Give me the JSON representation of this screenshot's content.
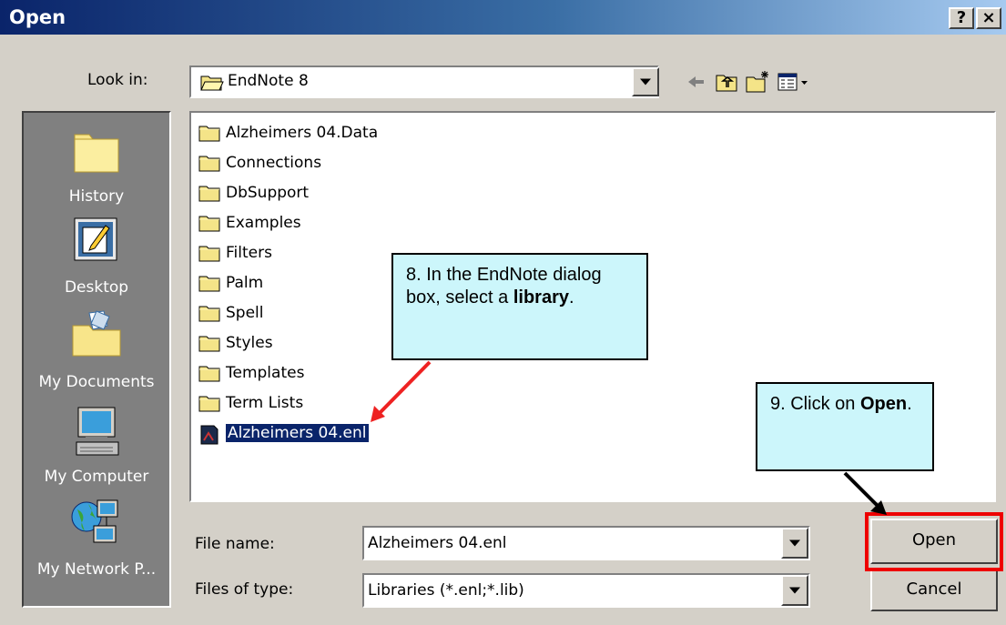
{
  "title": "Open",
  "title_buttons": {
    "help": "?",
    "close": "×"
  },
  "look_in": {
    "label": "Look in:",
    "value": "EndNote 8"
  },
  "toolbar": [
    "back-arrow-icon",
    "up-folder-icon",
    "new-folder-icon",
    "view-menu-icon"
  ],
  "places": [
    {
      "label": "History",
      "icon": "history-folder-icon"
    },
    {
      "label": "Desktop",
      "icon": "desktop-icon"
    },
    {
      "label": "My Documents",
      "icon": "my-documents-icon"
    },
    {
      "label": "My Computer",
      "icon": "my-computer-icon"
    },
    {
      "label": "My Network P...",
      "icon": "my-network-icon"
    }
  ],
  "files": [
    {
      "name": "Alzheimers 04.Data",
      "type": "folder"
    },
    {
      "name": "Connections",
      "type": "folder"
    },
    {
      "name": "DbSupport",
      "type": "folder"
    },
    {
      "name": "Examples",
      "type": "folder"
    },
    {
      "name": "Filters",
      "type": "folder"
    },
    {
      "name": "Palm",
      "type": "folder"
    },
    {
      "name": "Spell",
      "type": "folder"
    },
    {
      "name": "Styles",
      "type": "folder"
    },
    {
      "name": "Templates",
      "type": "folder"
    },
    {
      "name": "Term Lists",
      "type": "folder"
    },
    {
      "name": "Alzheimers 04.enl",
      "type": "library",
      "selected": true
    }
  ],
  "file_name": {
    "label": "File name:",
    "value": "Alzheimers 04.enl"
  },
  "files_of_type": {
    "label": "Files of type:",
    "value": "Libraries (*.enl;*.lib)"
  },
  "buttons": {
    "open": "Open",
    "cancel": "Cancel"
  },
  "callouts": [
    {
      "text": "8. In the EndNote dialog box, select a ",
      "bold": "library",
      "after": "."
    },
    {
      "text": "9. Click on ",
      "bold": "Open",
      "after": "."
    }
  ],
  "colors": {
    "title_bar": "#0a246a",
    "callout_bg": "#ccf6fb",
    "highlight": "#ee0000",
    "arrow_red": "#ee2222",
    "selection": "#0a246a"
  }
}
